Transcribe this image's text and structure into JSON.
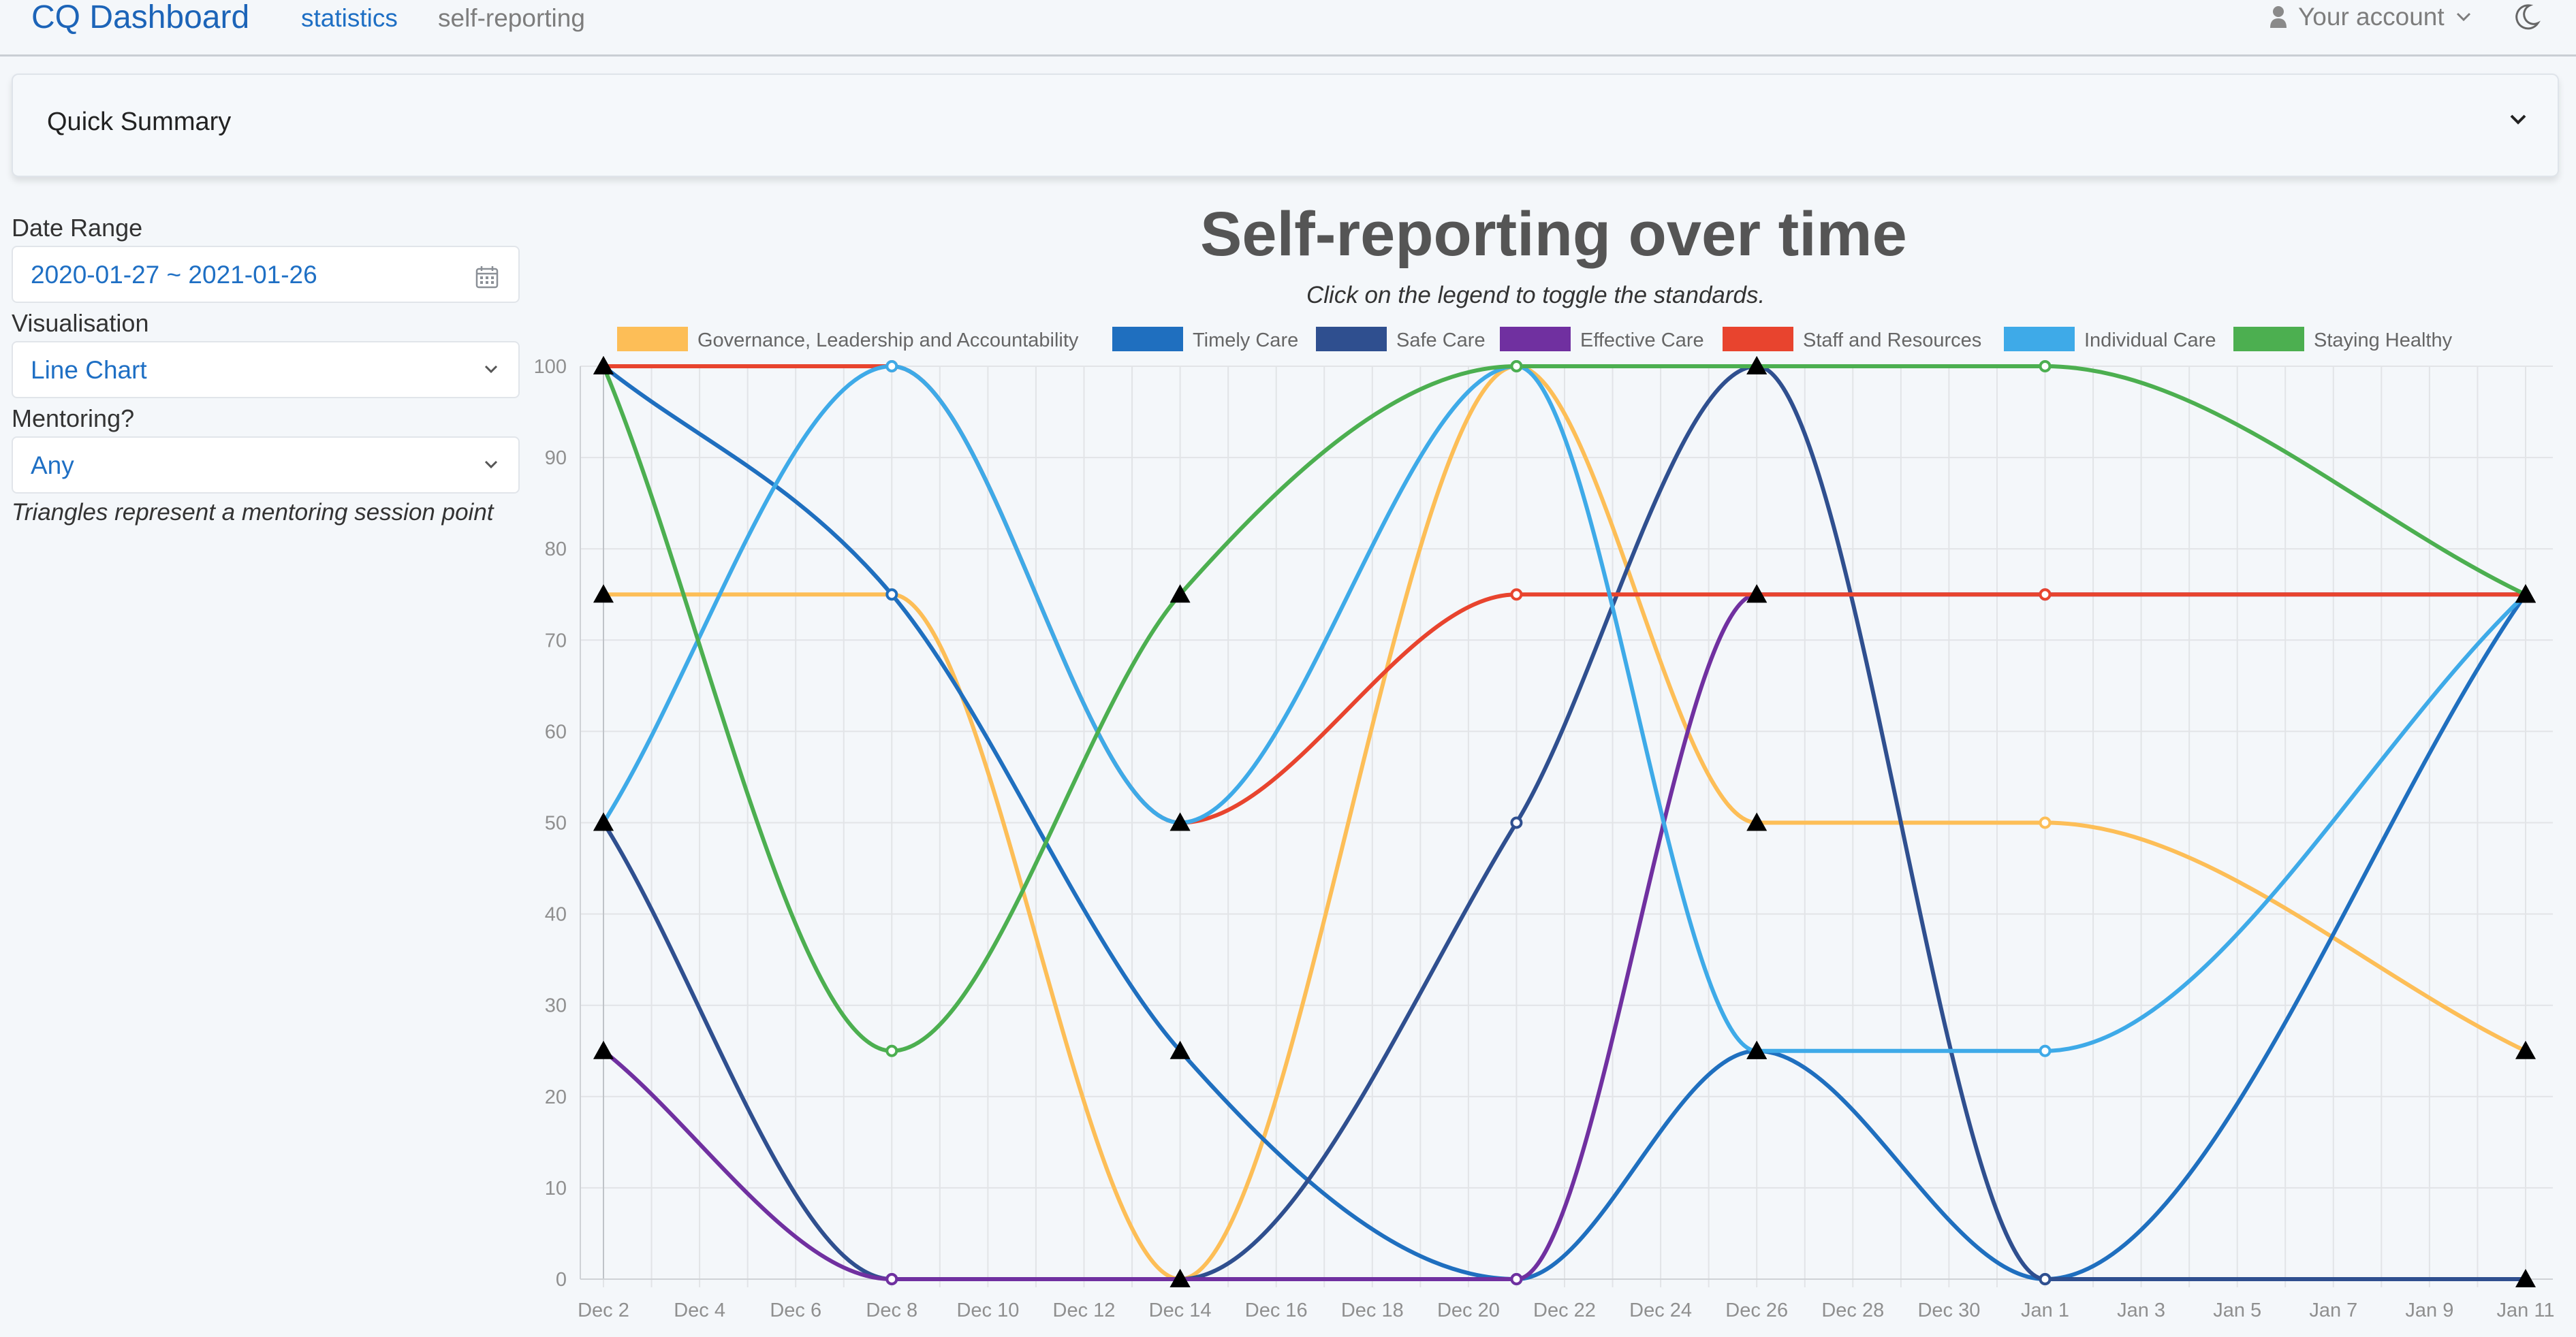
{
  "header": {
    "brand": "CQ Dashboard",
    "nav": [
      "statistics",
      "self-reporting"
    ],
    "account": "Your account"
  },
  "summary": {
    "title": "Quick Summary"
  },
  "filters": {
    "date_range_label": "Date Range",
    "date_range_value": "2020-01-27 ~ 2021-01-26",
    "visualisation_label": "Visualisation",
    "visualisation_value": "Line Chart",
    "mentoring_label": "Mentoring?",
    "mentoring_value": "Any",
    "note": "Triangles represent a mentoring session point"
  },
  "chart": {
    "title": "Self-reporting over time",
    "subtitle": "Click on the legend to toggle the standards."
  },
  "chart_data": {
    "type": "line",
    "title": "Self-reporting over time",
    "subtitle": "Click on the legend to toggle the standards.",
    "x_tick_labels": [
      "Dec 2",
      "Dec 4",
      "Dec 6",
      "Dec 8",
      "Dec 10",
      "Dec 12",
      "Dec 14",
      "Dec 16",
      "Dec 18",
      "Dec 20",
      "Dec 22",
      "Dec 24",
      "Dec 26",
      "Dec 28",
      "Dec 30",
      "Jan 1",
      "Jan 3",
      "Jan 5",
      "Jan 7",
      "Jan 9",
      "Jan 11"
    ],
    "y_ticks": [
      0,
      10,
      20,
      30,
      40,
      50,
      60,
      70,
      80,
      90,
      100
    ],
    "ylim": [
      0,
      100
    ],
    "grid": true,
    "legend_position": "top",
    "series": [
      {
        "name": "Governance, Leadership and Accountability",
        "color": "#fdbe57",
        "points": [
          [
            "Dec 2",
            75,
            true
          ],
          [
            "Dec 8",
            75,
            false
          ],
          [
            "Dec 14",
            0,
            true
          ],
          [
            "Dec 21",
            100,
            false
          ],
          [
            "Dec 26",
            50,
            true
          ],
          [
            "Jan 1",
            50,
            false
          ],
          [
            "Jan 11",
            25,
            true
          ]
        ]
      },
      {
        "name": "Timely Care",
        "color": "#1f6fbf",
        "points": [
          [
            "Dec 2",
            100,
            true
          ],
          [
            "Dec 8",
            75,
            false
          ],
          [
            "Dec 14",
            25,
            true
          ],
          [
            "Dec 21",
            0,
            false
          ],
          [
            "Dec 26",
            25,
            true
          ],
          [
            "Jan 1",
            0,
            false
          ],
          [
            "Jan 11",
            75,
            true
          ]
        ]
      },
      {
        "name": "Safe Care",
        "color": "#2f4f8f",
        "points": [
          [
            "Dec 2",
            50,
            true
          ],
          [
            "Dec 8",
            0,
            false
          ],
          [
            "Dec 14",
            0,
            true
          ],
          [
            "Dec 21",
            50,
            false
          ],
          [
            "Dec 26",
            100,
            true
          ],
          [
            "Jan 1",
            0,
            false
          ],
          [
            "Jan 11",
            0,
            true
          ]
        ]
      },
      {
        "name": "Effective Care",
        "color": "#7030a0",
        "points": [
          [
            "Dec 2",
            25,
            true
          ],
          [
            "Dec 8",
            0,
            false
          ],
          [
            "Dec 14",
            0,
            true
          ],
          [
            "Dec 21",
            0,
            false
          ],
          [
            "Dec 26",
            75,
            true
          ],
          [
            "Jan 1",
            75,
            false
          ],
          [
            "Jan 11",
            75,
            true
          ]
        ]
      },
      {
        "name": "Staff and Resources",
        "color": "#e8442e",
        "points": [
          [
            "Dec 2",
            100,
            true
          ],
          [
            "Dec 8",
            100,
            false
          ],
          [
            "Dec 14",
            50,
            true
          ],
          [
            "Dec 21",
            75,
            false
          ],
          [
            "Dec 26",
            75,
            true
          ],
          [
            "Jan 1",
            75,
            false
          ],
          [
            "Jan 11",
            75,
            true
          ]
        ]
      },
      {
        "name": "Individual Care",
        "color": "#3eaae8",
        "points": [
          [
            "Dec 2",
            50,
            true
          ],
          [
            "Dec 8",
            100,
            false
          ],
          [
            "Dec 14",
            50,
            true
          ],
          [
            "Dec 21",
            100,
            false
          ],
          [
            "Dec 26",
            25,
            true
          ],
          [
            "Jan 1",
            25,
            false
          ],
          [
            "Jan 11",
            75,
            true
          ]
        ]
      },
      {
        "name": "Staying Healthy",
        "color": "#4caf50",
        "points": [
          [
            "Dec 2",
            100,
            true
          ],
          [
            "Dec 8",
            25,
            false
          ],
          [
            "Dec 14",
            75,
            true
          ],
          [
            "Dec 21",
            100,
            false
          ],
          [
            "Dec 26",
            100,
            true
          ],
          [
            "Jan 1",
            100,
            false
          ],
          [
            "Jan 11",
            75,
            true
          ]
        ]
      }
    ]
  }
}
